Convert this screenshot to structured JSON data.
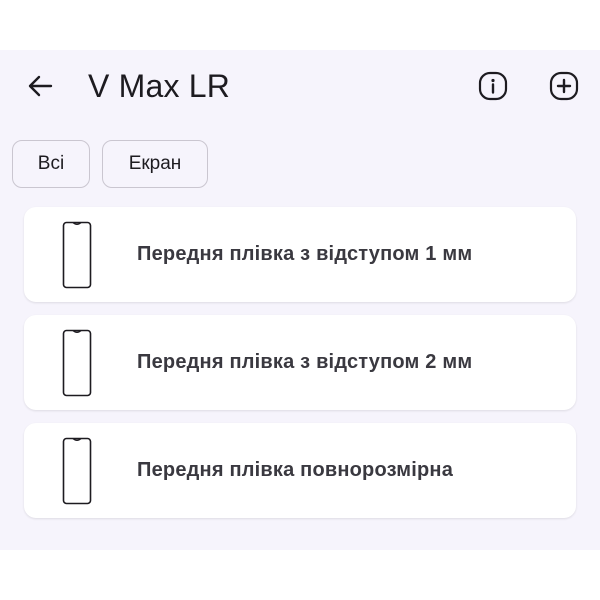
{
  "header": {
    "title": "V Max LR",
    "back_icon": "arrow-left-icon",
    "info_icon": "info-icon",
    "add_icon": "add-icon"
  },
  "filters": [
    {
      "label": "Всі"
    },
    {
      "label": "Екран"
    }
  ],
  "items": [
    {
      "label": "Передня плівка з відступом 1 мм",
      "icon": "phone-outline-icon"
    },
    {
      "label": "Передня плівка з відступом 2 мм",
      "icon": "phone-outline-icon"
    },
    {
      "label": "Передня плівка повнорозмірна",
      "icon": "phone-outline-icon"
    }
  ],
  "colors": {
    "background": "#f6f4fc",
    "card": "#ffffff",
    "text": "#1d1b20",
    "item_text": "#3a3940",
    "chip_border": "#cac6d0"
  }
}
